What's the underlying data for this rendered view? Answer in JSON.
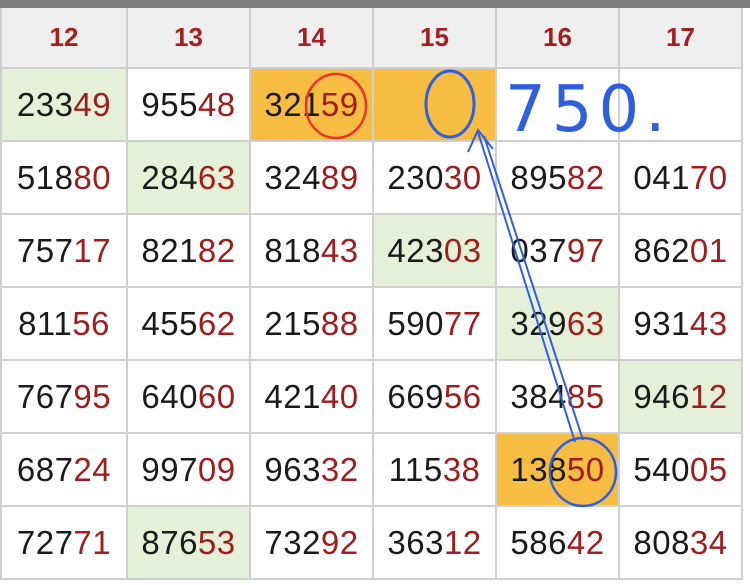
{
  "header": [
    "12",
    "13",
    "14",
    "15",
    "16",
    "17"
  ],
  "rows": [
    [
      {
        "p": "233",
        "s": "49",
        "bg": "green"
      },
      {
        "p": "955",
        "s": "48",
        "bg": ""
      },
      {
        "p": "321",
        "s": "59",
        "bg": "orange"
      },
      {
        "p": "",
        "s": "",
        "bg": "orange"
      },
      {
        "p": "",
        "s": "",
        "bg": ""
      },
      {
        "p": "",
        "s": "",
        "bg": ""
      }
    ],
    [
      {
        "p": "518",
        "s": "80",
        "bg": ""
      },
      {
        "p": "284",
        "s": "63",
        "bg": "green"
      },
      {
        "p": "324",
        "s": "89",
        "bg": ""
      },
      {
        "p": "230",
        "s": "30",
        "bg": ""
      },
      {
        "p": "895",
        "s": "82",
        "bg": ""
      },
      {
        "p": "041",
        "s": "70",
        "bg": ""
      }
    ],
    [
      {
        "p": "757",
        "s": "17",
        "bg": ""
      },
      {
        "p": "821",
        "s": "82",
        "bg": ""
      },
      {
        "p": "818",
        "s": "43",
        "bg": ""
      },
      {
        "p": "423",
        "s": "03",
        "bg": "green"
      },
      {
        "p": "037",
        "s": "97",
        "bg": ""
      },
      {
        "p": "862",
        "s": "01",
        "bg": ""
      }
    ],
    [
      {
        "p": "811",
        "s": "56",
        "bg": ""
      },
      {
        "p": "455",
        "s": "62",
        "bg": ""
      },
      {
        "p": "215",
        "s": "88",
        "bg": ""
      },
      {
        "p": "590",
        "s": "77",
        "bg": ""
      },
      {
        "p": "329",
        "s": "63",
        "bg": "green"
      },
      {
        "p": "931",
        "s": "43",
        "bg": ""
      }
    ],
    [
      {
        "p": "767",
        "s": "95",
        "bg": ""
      },
      {
        "p": "640",
        "s": "60",
        "bg": ""
      },
      {
        "p": "421",
        "s": "40",
        "bg": ""
      },
      {
        "p": "669",
        "s": "56",
        "bg": ""
      },
      {
        "p": "384",
        "s": "85",
        "bg": ""
      },
      {
        "p": "946",
        "s": "12",
        "bg": "green"
      }
    ],
    [
      {
        "p": "687",
        "s": "24",
        "bg": ""
      },
      {
        "p": "997",
        "s": "09",
        "bg": ""
      },
      {
        "p": "963",
        "s": "32",
        "bg": ""
      },
      {
        "p": "115",
        "s": "38",
        "bg": ""
      },
      {
        "p": "138",
        "s": "50",
        "bg": "orange"
      },
      {
        "p": "540",
        "s": "05",
        "bg": ""
      }
    ],
    [
      {
        "p": "727",
        "s": "71",
        "bg": ""
      },
      {
        "p": "876",
        "s": "53",
        "bg": "green"
      },
      {
        "p": "732",
        "s": "92",
        "bg": ""
      },
      {
        "p": "363",
        "s": "12",
        "bg": ""
      },
      {
        "p": "586",
        "s": "42",
        "bg": ""
      },
      {
        "p": "808",
        "s": "34",
        "bg": ""
      }
    ]
  ],
  "annotations": {
    "handwritten_note": "750.",
    "predicted_digit": "0",
    "ink_colors": {
      "blue": "#2f5fe0",
      "red": "#e8352b"
    }
  },
  "colors": {
    "header_text": "#a31f1f",
    "suffix_text": "#a01d1d",
    "green_cell": "#e4f0d8",
    "orange_cell": "#f6bd42",
    "grid_line": "#cfcfcf"
  }
}
